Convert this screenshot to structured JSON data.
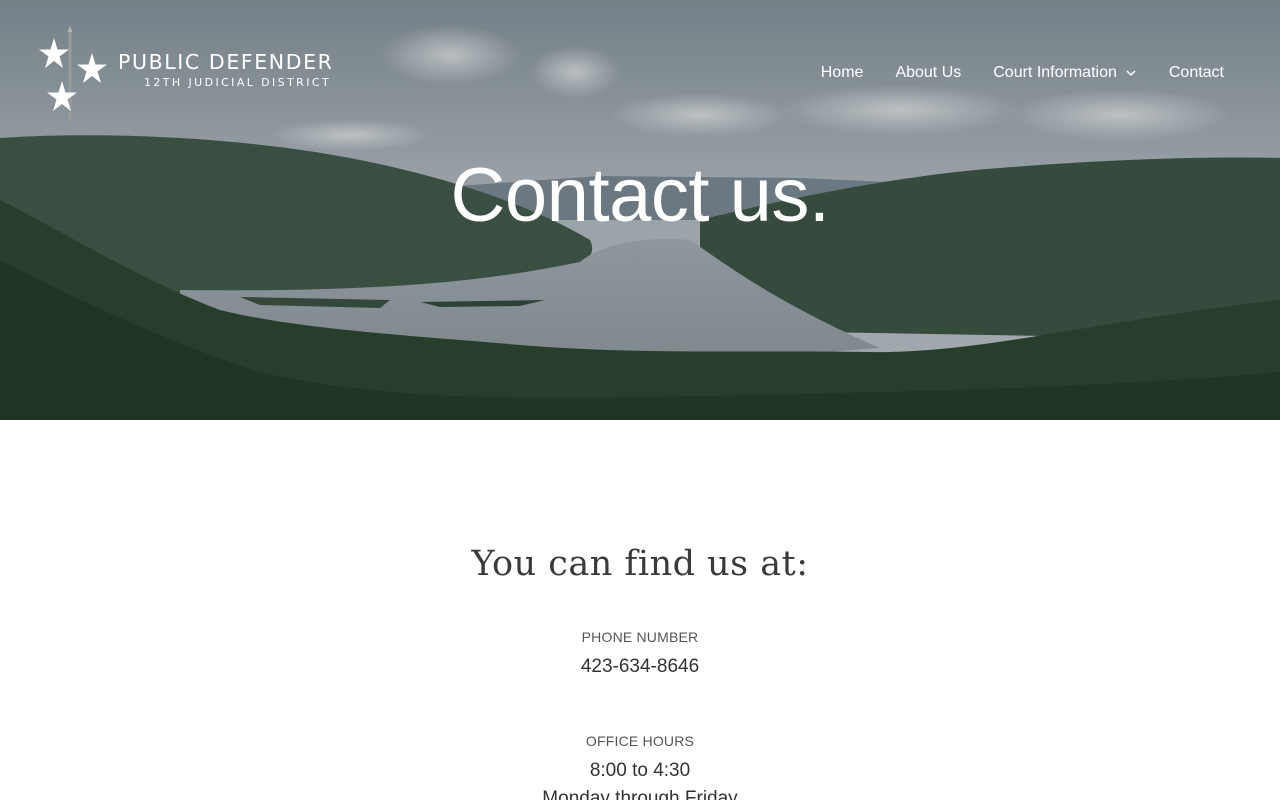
{
  "header": {
    "logo": {
      "title": "PUBLIC DEFENDER",
      "subtitle": "12TH JUDICIAL DISTRICT",
      "icon": "three-stars-sword-emblem"
    },
    "nav": {
      "items": [
        {
          "label": "Home"
        },
        {
          "label": "About Us"
        },
        {
          "label": "Court Information",
          "has_dropdown": true,
          "icon": "chevron-down-icon"
        },
        {
          "label": "Contact"
        }
      ]
    }
  },
  "hero": {
    "title": "Contact us.",
    "background": "river-valley-landscape-photo"
  },
  "main": {
    "heading": "You can find us at:",
    "phone": {
      "label": "PHONE NUMBER",
      "value": "423-634-8646"
    },
    "hours": {
      "label": "OFFICE HOURS",
      "value": "8:00 to 4:30",
      "days": "Monday through Friday"
    }
  },
  "colors": {
    "nav_text": "#ffffff",
    "heading_text": "#3a3a3a",
    "label_text": "#555555",
    "body_text": "#333333",
    "page_background": "#ffffff"
  }
}
